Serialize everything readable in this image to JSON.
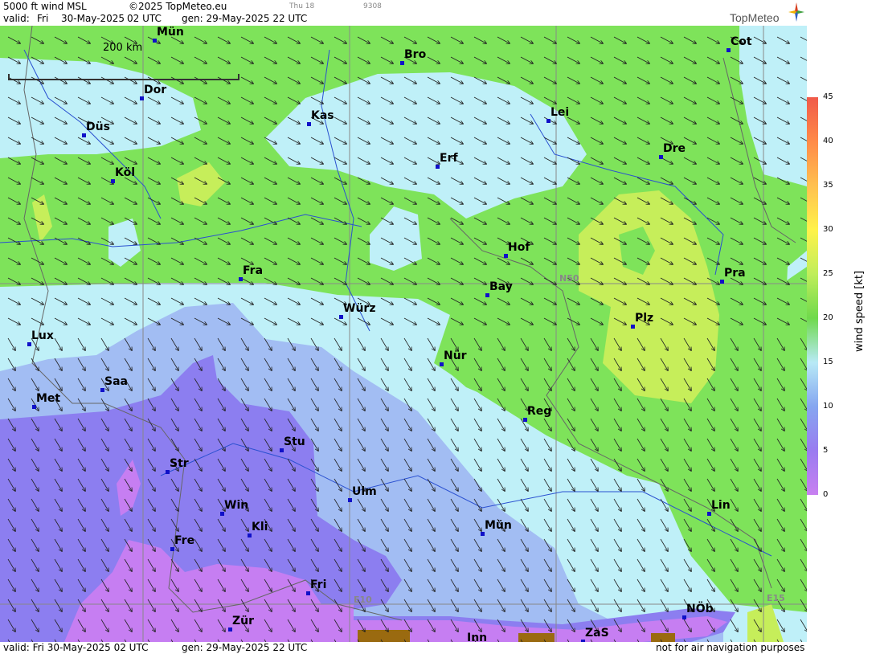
{
  "header": {
    "product": "5000 ft wind MSL",
    "copyright": "©2025 TopMeteo.eu",
    "valid_label": "valid:",
    "valid_day": "Fri",
    "valid_date": "30-May-2025",
    "valid_time": "02 UTC",
    "gen": "gen: 29-May-2025 22 UTC",
    "small1": "Thu 18",
    "small2": "9308",
    "brand": "TopMeteo"
  },
  "footer": {
    "valid": "valid:  Fri  30-May-2025  02 UTC",
    "gen": "gen: 29-May-2025 22 UTC",
    "notice": "not for air navigation purposes"
  },
  "map": {
    "scale_bar": "200 km",
    "grid_labels": [
      "N50",
      "E10",
      "E15"
    ],
    "cities": [
      "Mün",
      "Bro",
      "Cot",
      "Dor",
      "Kas",
      "Lei",
      "Düs",
      "Erf",
      "Dre",
      "Köl",
      "Hof",
      "Pra",
      "Fra",
      "Bay",
      "Würz",
      "Plz",
      "Lux",
      "Nür",
      "Saa",
      "Met",
      "Reg",
      "Stu",
      "Str",
      "Ulm",
      "Win",
      "Kli",
      "Mün",
      "Lin",
      "Fre",
      "Fri",
      "NÖb",
      "Zür",
      "ZaS",
      "Inn"
    ]
  },
  "legend": {
    "title": "wind speed [kt]",
    "ticks": [
      "0",
      "5",
      "10",
      "15",
      "20",
      "25",
      "30",
      "35",
      "40",
      "45"
    ],
    "colors": [
      "#c880f0",
      "#9a7cf0",
      "#86a6f0",
      "#b8eaf6",
      "#6fd94c",
      "#c0ee5a",
      "#fff24a",
      "#ffc050",
      "#ff8a48",
      "#f05a4a"
    ]
  },
  "colors": {
    "fill_light_green": "#7ee35a",
    "fill_cyan": "#bff0f8",
    "fill_blue": "#a2bdf3",
    "fill_violet": "#8c7ef0",
    "fill_pink": "#c67ef2",
    "fill_yellow_green": "#c6ee5a",
    "terrain_brown": "#9a6a10"
  }
}
